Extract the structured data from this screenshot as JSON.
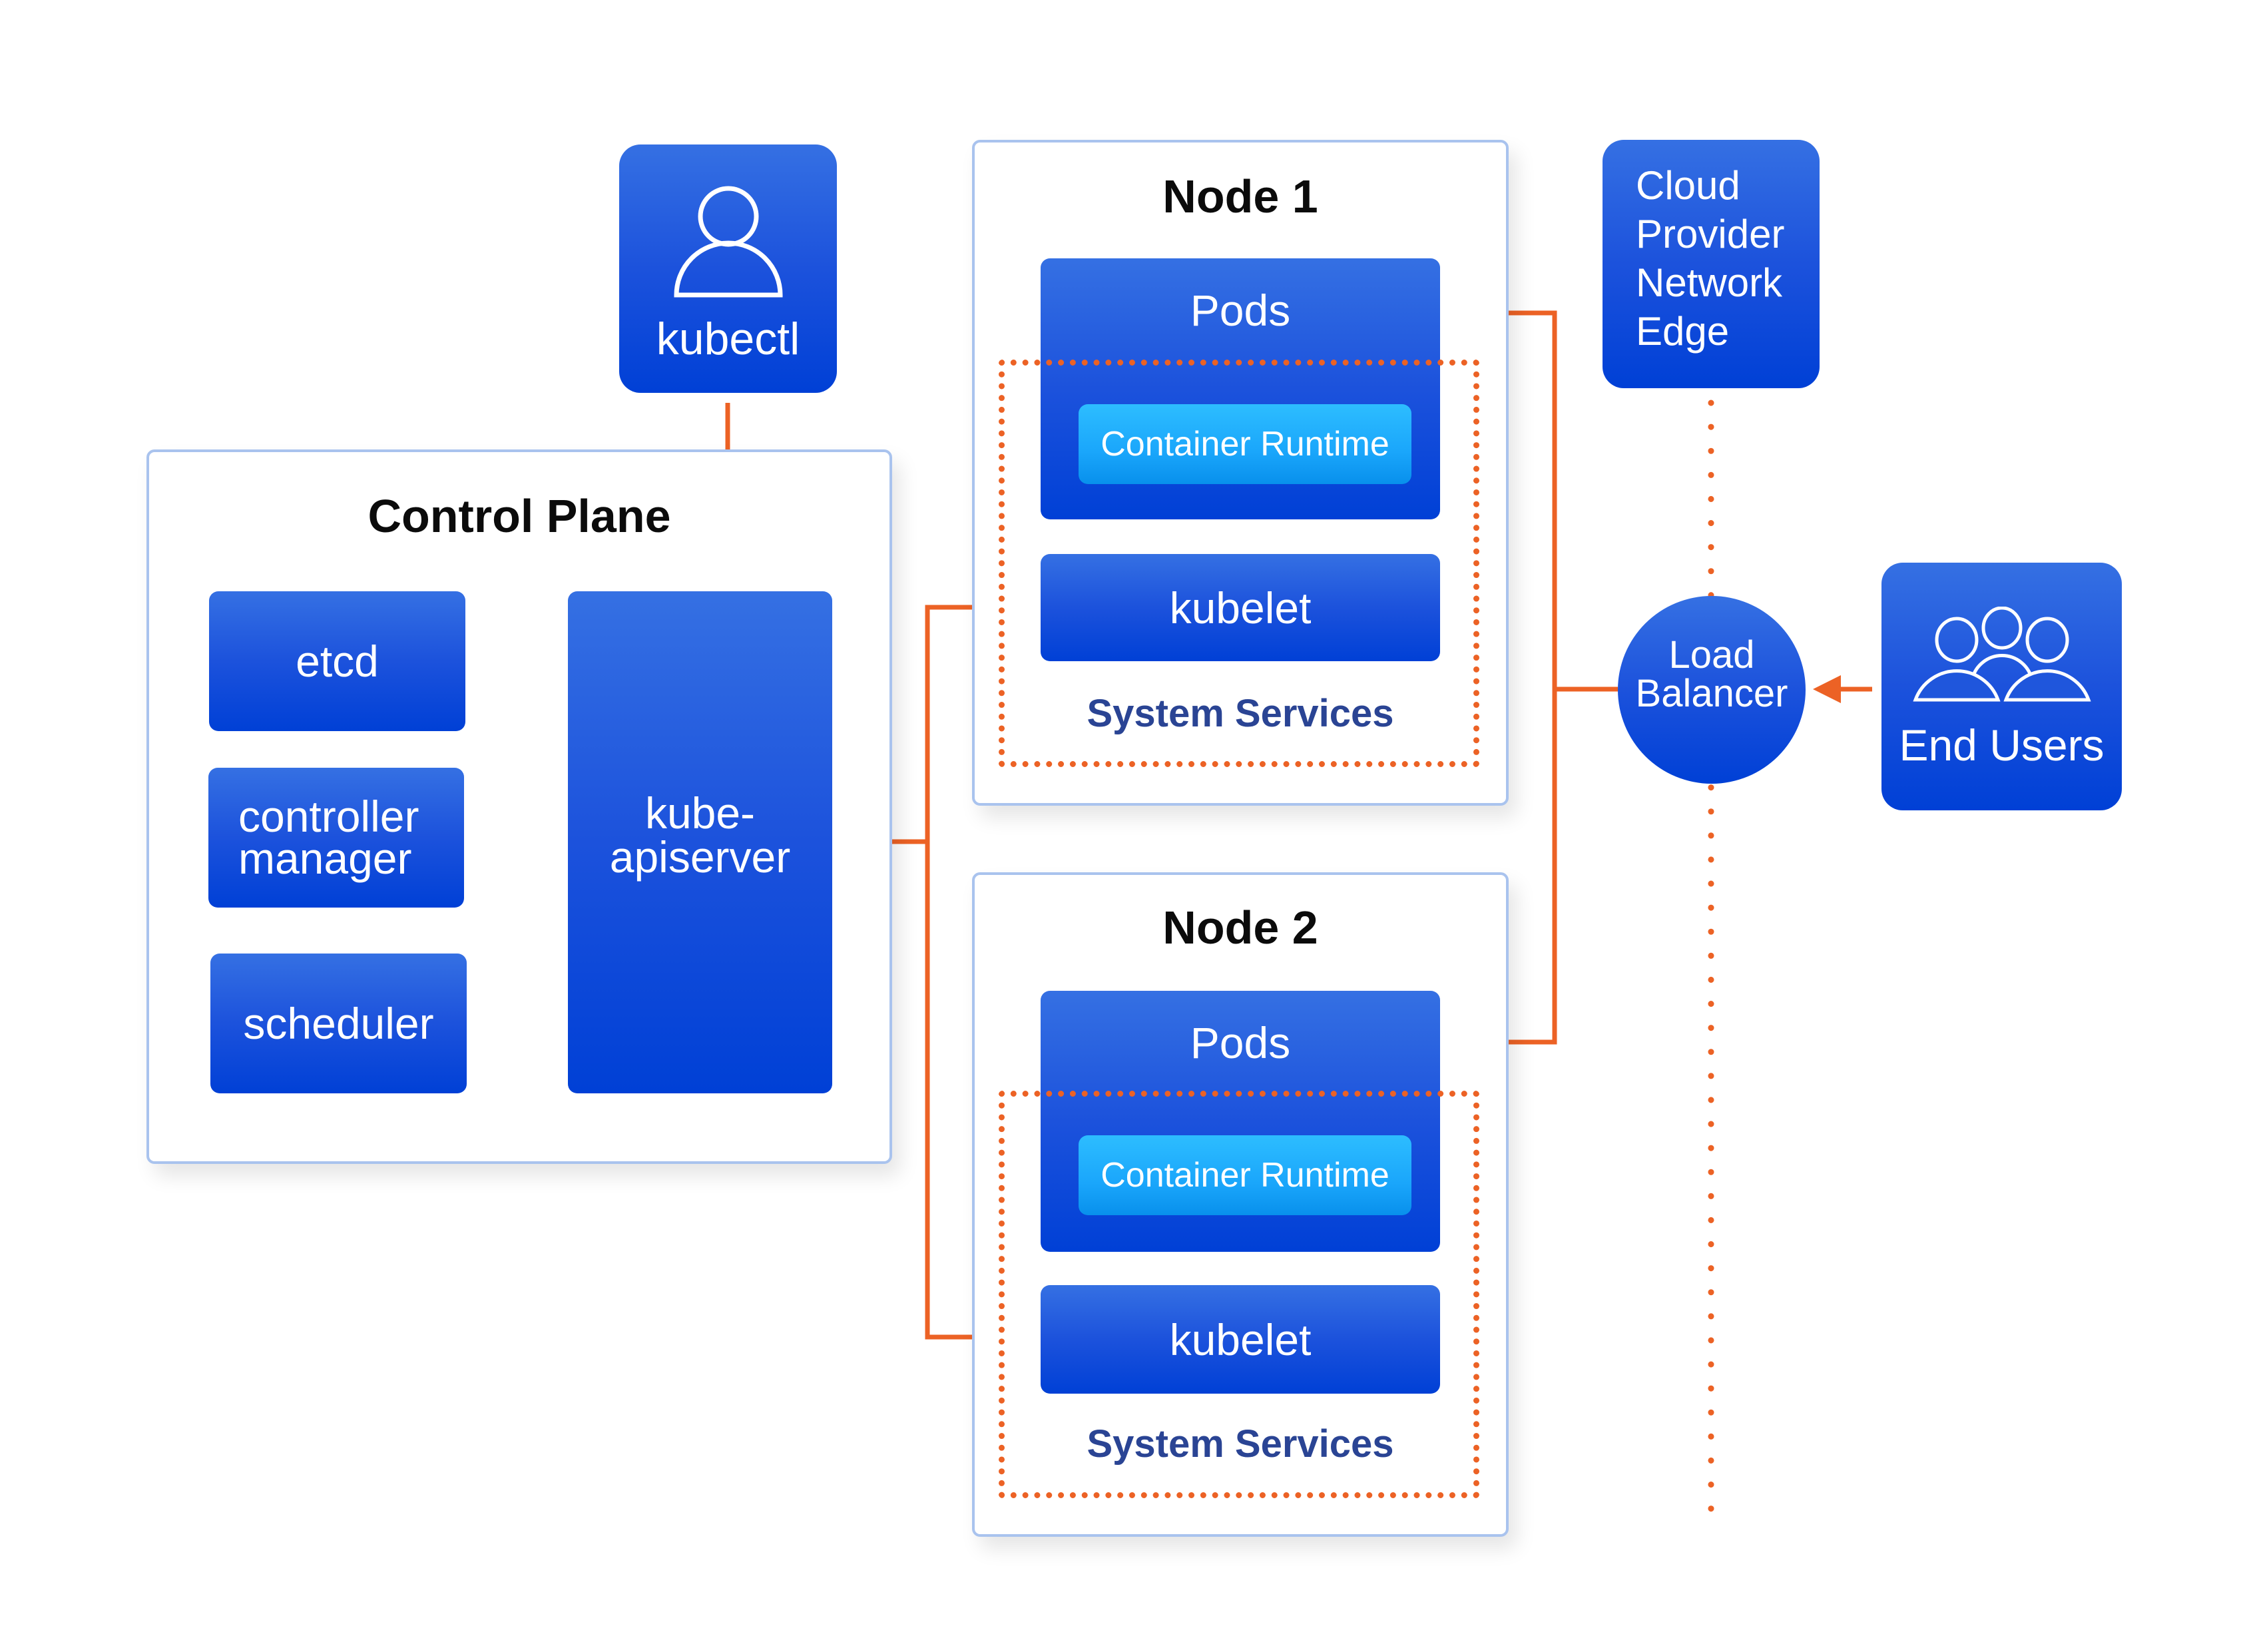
{
  "diagram": {
    "kubectl": {
      "label": "kubectl",
      "icon": "user-icon"
    },
    "control_plane": {
      "title": "Control Plane",
      "components": [
        "etcd",
        "controller manager",
        "scheduler"
      ],
      "apiserver": {
        "line1": "kube-",
        "line2": "apiserver"
      }
    },
    "nodes": [
      {
        "title": "Node 1",
        "pods": "Pods",
        "runtime": "Container Runtime",
        "kubelet": "kubelet",
        "system": "System Services"
      },
      {
        "title": "Node 2",
        "pods": "Pods",
        "runtime": "Container Runtime",
        "kubelet": "kubelet",
        "system": "System Services"
      }
    ],
    "cloud_edge": {
      "lines": [
        "Cloud",
        "Provider",
        "Network",
        "Edge"
      ]
    },
    "load_balancer": {
      "line1": "Load",
      "line2": "Balancer"
    },
    "end_users": {
      "label": "End Users",
      "icon": "users-group-icon"
    },
    "colors": {
      "accent_blue": "#1c52dc",
      "arrow_orange": "#ec6225",
      "runtime_cyan": "#1aa6fb",
      "panel_border": "#a9c3ee",
      "system_text": "#2a4494"
    }
  }
}
